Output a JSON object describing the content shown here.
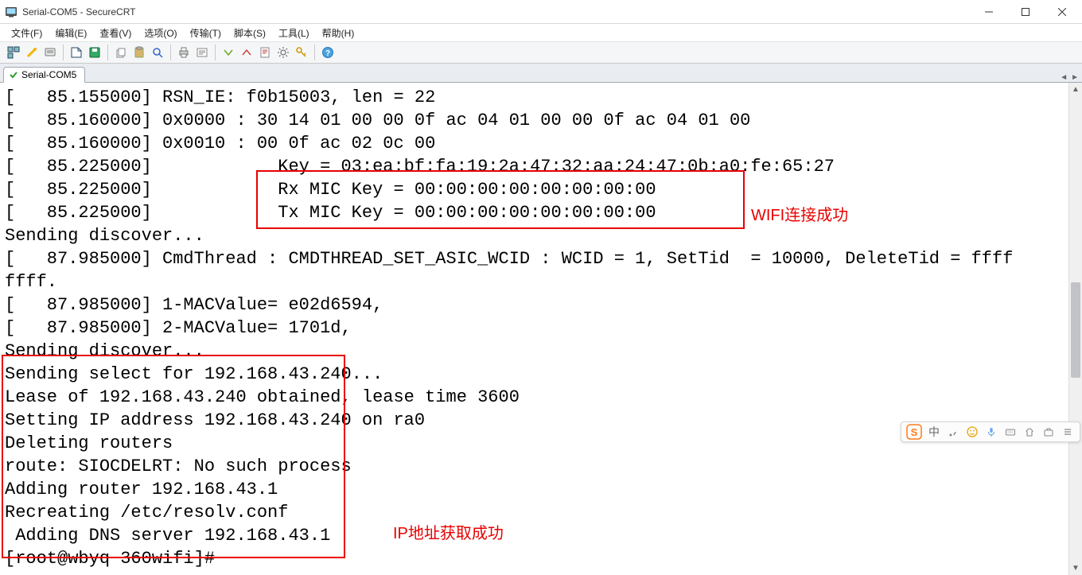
{
  "window": {
    "title": "Serial-COM5 - SecureCRT"
  },
  "menubar": {
    "items": [
      {
        "label": "文件(F)"
      },
      {
        "label": "编辑(E)"
      },
      {
        "label": "查看(V)"
      },
      {
        "label": "选项(O)"
      },
      {
        "label": "传输(T)"
      },
      {
        "label": "脚本(S)"
      },
      {
        "label": "工具(L)"
      },
      {
        "label": "帮助(H)"
      }
    ]
  },
  "toolbar": {
    "icons": [
      "session-manager",
      "quick-connect",
      "reconnect",
      "sep",
      "new-tab",
      "print",
      "sep",
      "copy",
      "paste",
      "find",
      "sep",
      "properties",
      "help",
      "sep",
      "trace",
      "lock",
      "xmodem",
      "settings",
      "key",
      "sep",
      "about"
    ]
  },
  "tab": {
    "label": "Serial-COM5"
  },
  "terminal": {
    "lines": [
      "[   85.155000] RSN_IE: f0b15003, len = 22",
      "[   85.160000] 0x0000 : 30 14 01 00 00 0f ac 04 01 00 00 0f ac 04 01 00",
      "[   85.160000] 0x0010 : 00 0f ac 02 0c 00",
      "[   85.225000]            Key = 03:ea:bf:fa:19:2a:47:32:aa:24:47:0b:a0:fe:65:27",
      "[   85.225000]            Rx MIC Key = 00:00:00:00:00:00:00:00",
      "[   85.225000]            Tx MIC Key = 00:00:00:00:00:00:00:00",
      "Sending discover...",
      "[   87.985000] CmdThread : CMDTHREAD_SET_ASIC_WCID : WCID = 1, SetTid  = 10000, DeleteTid = ffff",
      "ffff.",
      "[   87.985000] 1-MACValue= e02d6594,",
      "[   87.985000] 2-MACValue= 1701d,",
      "Sending discover...",
      "Sending select for 192.168.43.240...",
      "Lease of 192.168.43.240 obtained, lease time 3600",
      "Setting IP address 192.168.43.240 on ra0",
      "Deleting routers",
      "route: SIOCDELRT: No such process",
      "Adding router 192.168.43.1",
      "Recreating /etc/resolv.conf",
      " Adding DNS server 192.168.43.1",
      "[root@wbyq 360wifi]#"
    ]
  },
  "annotations": {
    "wifi_label": "WIFI连接成功",
    "ip_label": "IP地址获取成功"
  },
  "ime": {
    "zhong": "中"
  }
}
